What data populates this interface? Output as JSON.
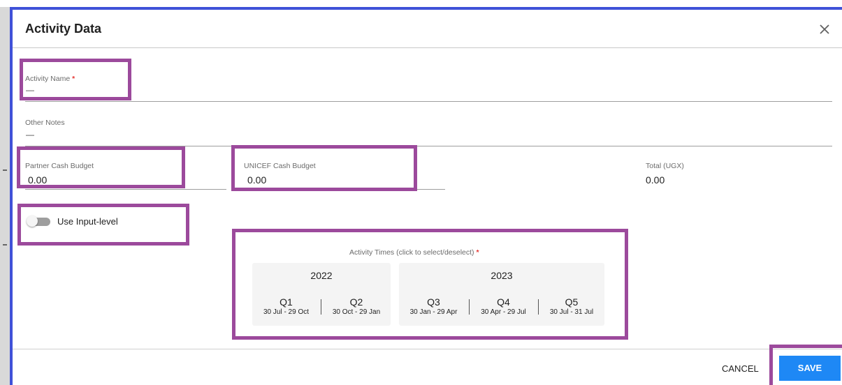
{
  "dialog": {
    "title": "Activity Data",
    "close_icon": "close-icon"
  },
  "fields": {
    "activity_name": {
      "label": "Activity Name",
      "required_mark": "*",
      "value": "—"
    },
    "other_notes": {
      "label": "Other Notes",
      "value": "—"
    },
    "partner_cash_budget": {
      "label": "Partner Cash Budget",
      "value": "0.00"
    },
    "unicef_cash_budget": {
      "label": "UNICEF Cash Budget",
      "value": "0.00"
    },
    "total": {
      "label": "Total (UGX)",
      "value": "0.00"
    }
  },
  "input_level": {
    "label": "Use Input-level",
    "enabled": false
  },
  "activity_times": {
    "label": "Activity Times (click to select/deselect)",
    "required_mark": "*",
    "years": [
      {
        "year": "2022",
        "quarters": [
          {
            "name": "Q1",
            "dates": "30 Jul - 29 Oct"
          },
          {
            "name": "Q2",
            "dates": "30 Oct - 29 Jan"
          }
        ]
      },
      {
        "year": "2023",
        "quarters": [
          {
            "name": "Q3",
            "dates": "30 Jan - 29 Apr"
          },
          {
            "name": "Q4",
            "dates": "30 Apr - 29 Jul"
          },
          {
            "name": "Q5",
            "dates": "30 Jul - 31 Jul"
          }
        ]
      }
    ]
  },
  "footer": {
    "cancel_label": "CANCEL",
    "save_label": "SAVE"
  },
  "colors": {
    "accent": "#1e88f5",
    "highlight": "#9c4a9c",
    "frame": "#3f51d8",
    "required": "#e53935"
  }
}
